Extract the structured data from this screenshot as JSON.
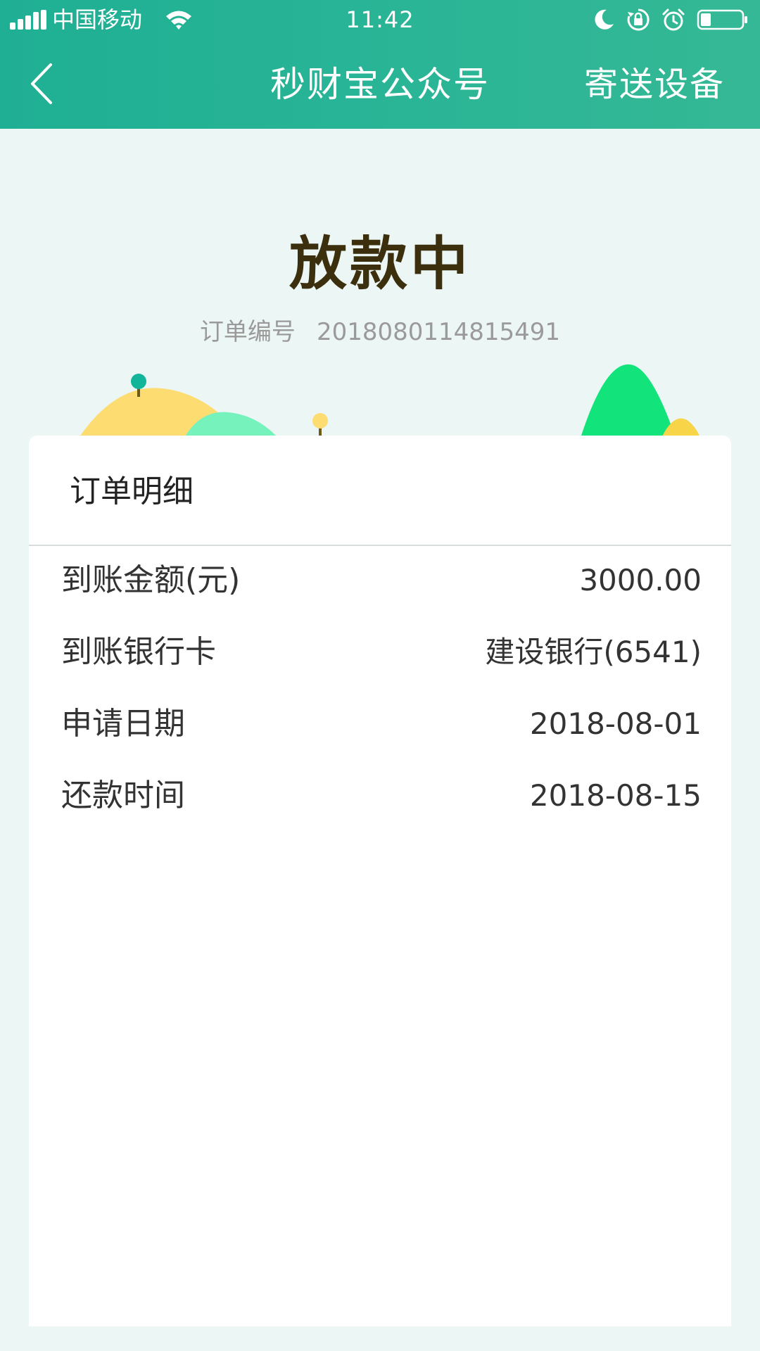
{
  "status_bar": {
    "carrier": "中国移动",
    "time": "11:42",
    "icons": [
      "signal-icon",
      "wifi-icon",
      "moon-icon",
      "rotation-lock-icon",
      "alarm-icon",
      "battery-icon"
    ],
    "battery_level": 0.25
  },
  "nav": {
    "back_icon": "chevron-left-icon",
    "title": "秒财宝公众号",
    "action_label": "寄送设备"
  },
  "order": {
    "status": "放款中",
    "number_label": "订单编号",
    "number": "2018080114815491"
  },
  "details": {
    "title": "订单明细",
    "rows": [
      {
        "label": "到账金额(元)",
        "value": "3000.00"
      },
      {
        "label": "到账银行卡",
        "value": "建设银行(6541)"
      },
      {
        "label": "申请日期",
        "value": "2018-08-01"
      },
      {
        "label": "还款时间",
        "value": "2018-08-15"
      }
    ]
  },
  "colors": {
    "header_bg": "#25b396",
    "page_bg": "#ecf6f4",
    "status_text": "#3b2f0e",
    "muted_text": "#9a9a9a",
    "hill_yellow": "#fddd72",
    "hill_mint": "#76f2bd",
    "hill_green": "#12e47b"
  }
}
